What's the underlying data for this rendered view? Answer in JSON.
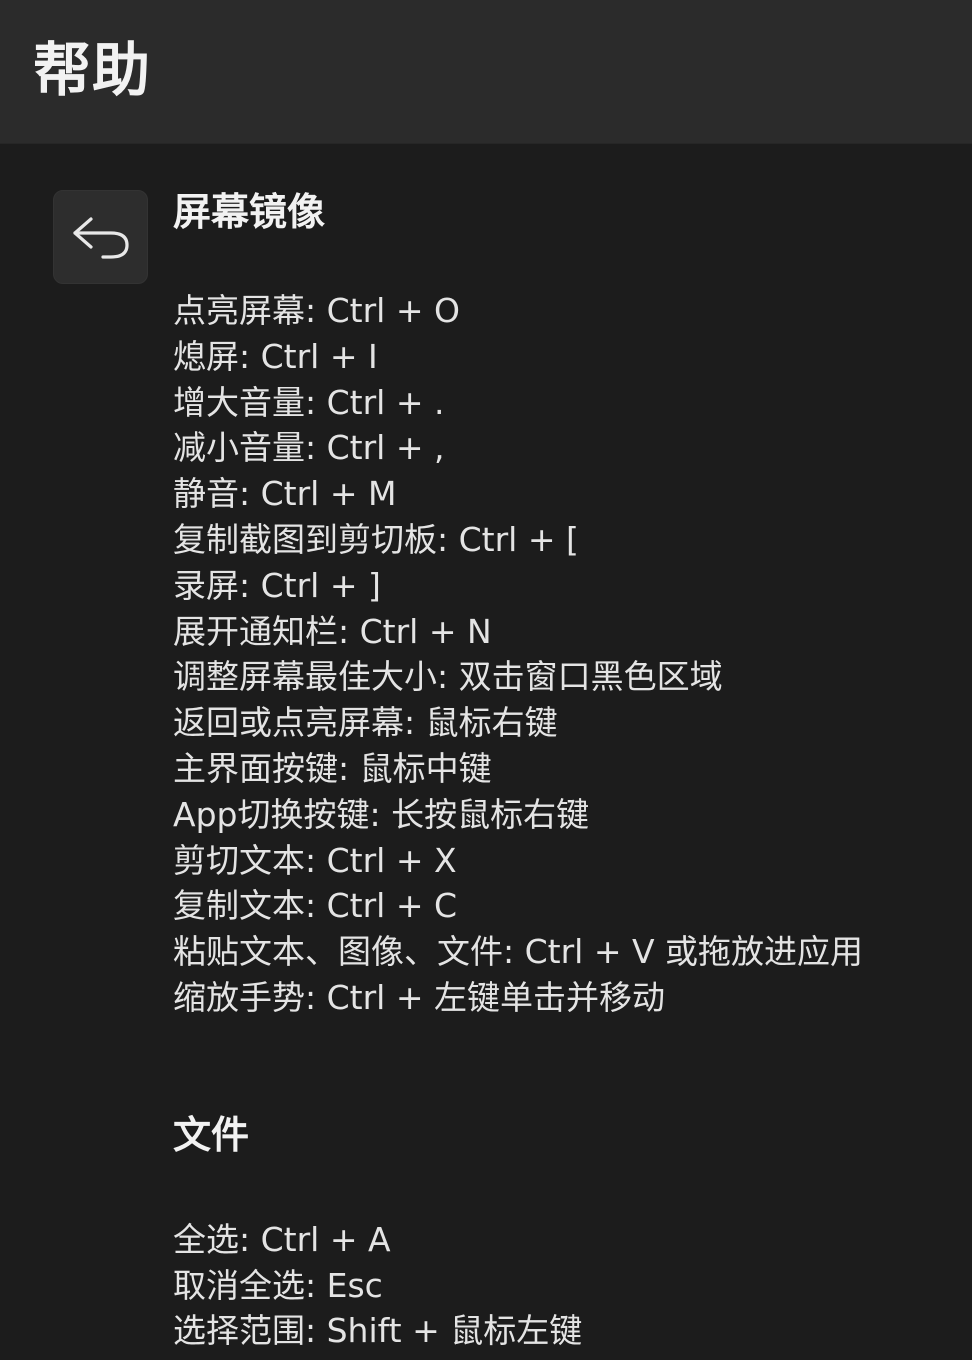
{
  "header": {
    "title": "帮助"
  },
  "icons": {
    "back": "back-arrow-icon"
  },
  "sections": [
    {
      "title": "屏幕镜像",
      "items": [
        "点亮屏幕: Ctrl + O",
        "熄屏: Ctrl + I",
        "增大音量: Ctrl + .",
        "减小音量: Ctrl + ,",
        "静音: Ctrl + M",
        "复制截图到剪切板: Ctrl + [",
        "录屏: Ctrl + ]",
        "展开通知栏: Ctrl + N",
        "调整屏幕最佳大小: 双击窗口黑色区域",
        "返回或点亮屏幕: 鼠标右键",
        "主界面按键: 鼠标中键",
        "App切换按键: 长按鼠标右键",
        "剪切文本: Ctrl + X",
        "复制文本: Ctrl + C",
        "粘贴文本、图像、文件: Ctrl + V 或拖放进应用",
        "缩放手势: Ctrl + 左键单击并移动"
      ]
    },
    {
      "title": "文件",
      "items": [
        "全选: Ctrl + A",
        "取消全选: Esc",
        "选择范围: Shift + 鼠标左键"
      ]
    }
  ]
}
